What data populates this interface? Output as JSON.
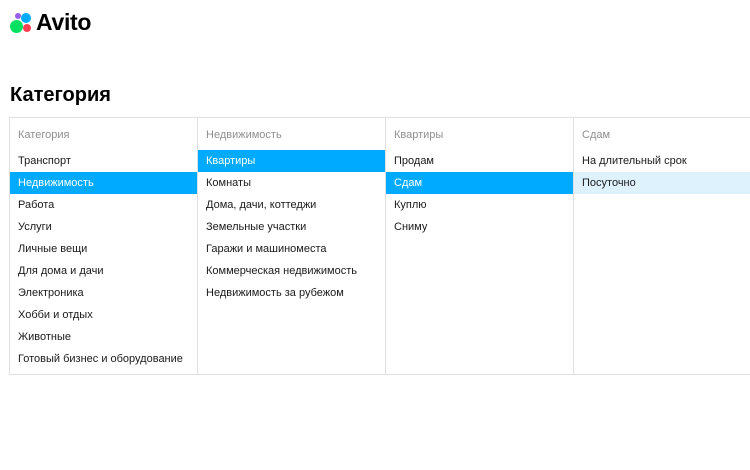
{
  "logo": {
    "text": "Avito"
  },
  "page_title": "Категория",
  "columns": [
    {
      "header": "Категория",
      "items": [
        "Транспорт",
        "Недвижимость",
        "Работа",
        "Услуги",
        "Личные вещи",
        "Для дома и дачи",
        "Электроника",
        "Хобби и отдых",
        "Животные",
        "Готовый бизнес и оборудование"
      ],
      "selected": "Недвижимость"
    },
    {
      "header": "Недвижимость",
      "items": [
        "Квартиры",
        "Комнаты",
        "Дома, дачи, коттеджи",
        "Земельные участки",
        "Гаражи и машиноместа",
        "Коммерческая недвижимость",
        "Недвижимость за рубежом"
      ],
      "selected": "Квартиры"
    },
    {
      "header": "Квартиры",
      "items": [
        "Продам",
        "Сдам",
        "Куплю",
        "Сниму"
      ],
      "selected": "Сдам"
    },
    {
      "header": "Сдам",
      "items": [
        "На длительный срок",
        "Посуточно"
      ],
      "hovered": "Посуточно"
    }
  ],
  "colors": {
    "selected_bg": "#00aaff",
    "hover_bg": "#def2fe",
    "border": "#e0e0e0"
  }
}
